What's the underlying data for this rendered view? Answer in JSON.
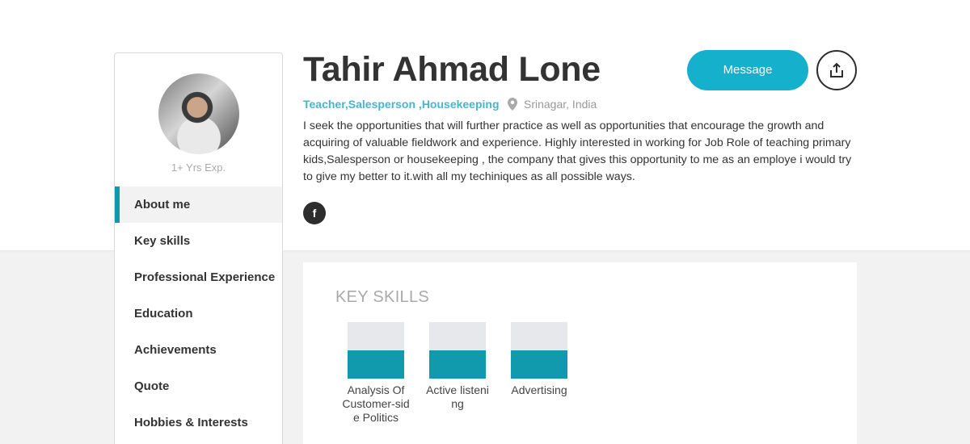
{
  "profile": {
    "name": "Tahir Ahmad Lone",
    "roles": "Teacher,Salesperson ,Housekeeping",
    "location": "Srinagar, India",
    "bio": "I seek the opportunities that will further practice as well as opportunities that encourage the growth and acquiring of valuable fieldwork and experience. Highly interested in working for Job Role of teaching primary kids,Salesperson or housekeeping , the company that gives this opportunity to me as an employe i would try to give my better to it.with all my techiniques as all possible ways.",
    "experience": "1+ Yrs Exp."
  },
  "actions": {
    "message_label": "Message",
    "share_icon": "share-upload-icon",
    "facebook_glyph": "f"
  },
  "sidebar": {
    "items": [
      {
        "label": "About me",
        "active": true
      },
      {
        "label": "Key skills",
        "active": false
      },
      {
        "label": "Professional Experience",
        "active": false
      },
      {
        "label": "Education",
        "active": false
      },
      {
        "label": "Achievements",
        "active": false
      },
      {
        "label": "Quote",
        "active": false
      },
      {
        "label": "Hobbies & Interests",
        "active": false
      }
    ]
  },
  "skills": {
    "title": "KEY SKILLS",
    "items": [
      {
        "label": "Analysis Of Customer-side Politics",
        "level": 0.5
      },
      {
        "label": "Active listening",
        "level": 0.5
      },
      {
        "label": "Advertising",
        "level": 0.5
      }
    ]
  },
  "colors": {
    "accent": "#14b0cc",
    "skill_fill": "#1199ad",
    "roles": "#46b6cc"
  }
}
